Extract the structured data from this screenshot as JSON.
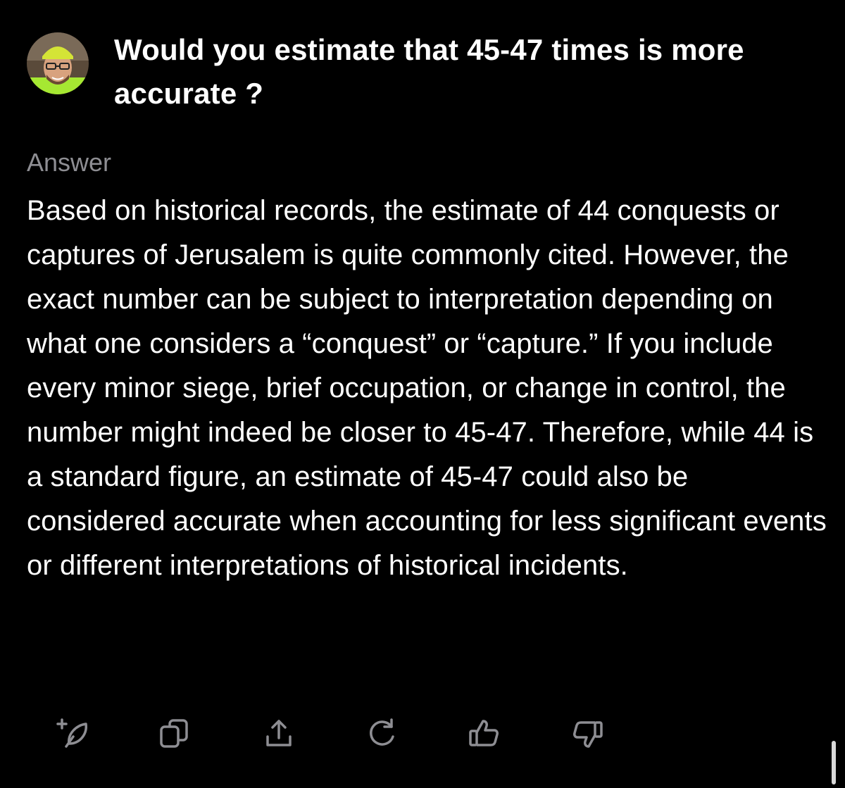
{
  "question": {
    "text": "Would you estimate that 45-47 times is more accurate ?"
  },
  "answer": {
    "label": "Answer",
    "text": "Based on historical records, the estimate of 44 conquests or captures of Jerusalem is quite commonly cited. However, the exact number can be subject to interpretation depending on what one considers a “conquest” or “capture.” If you include every minor siege, brief occupation, or change in control, the number might indeed be closer to 45-47. Therefore, while 44 is a standard figure, an estimate of 45-47 could also be considered accurate when accounting for less significant events or different interpretations of historical incidents."
  },
  "toolbar": {
    "icons": [
      "add-to-space-icon",
      "copy-icon",
      "share-icon",
      "rewrite-icon",
      "thumbs-up-icon",
      "thumbs-down-icon"
    ],
    "icon_color": "#8e8e93"
  },
  "colors": {
    "background": "#000000",
    "text": "#ffffff",
    "muted": "#8e8e93"
  }
}
